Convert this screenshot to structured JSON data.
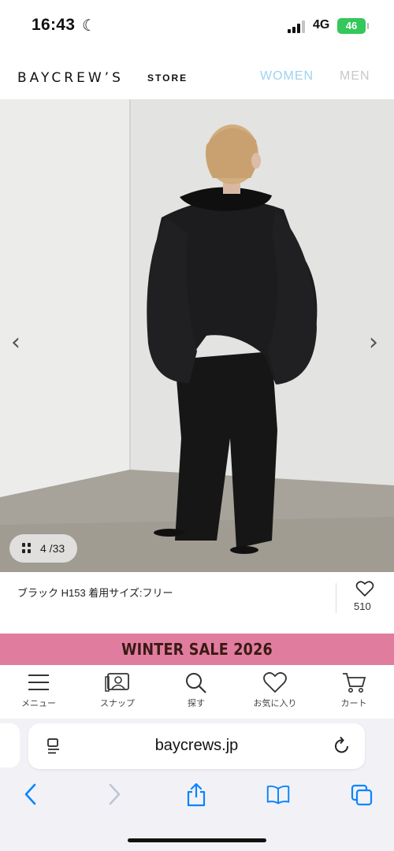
{
  "status_bar": {
    "time": "16:43",
    "network": "4G",
    "battery": "46"
  },
  "header": {
    "logo": "BAYCREW’S",
    "logo_suffix": "STORE",
    "nav_women": "WOMEN",
    "nav_men": "MEN"
  },
  "gallery": {
    "counter": "4 /33",
    "caption": "ブラック H153 着用サイズ:フリー",
    "like_count": "510"
  },
  "sale_banner": {
    "text": "WINTER SALE 2026"
  },
  "tabbar": {
    "items": [
      {
        "label": "メニュー",
        "icon": "hamburger-menu-icon"
      },
      {
        "label": "スナップ",
        "icon": "snap-photo-icon"
      },
      {
        "label": "探す",
        "icon": "search-icon"
      },
      {
        "label": "お気に入り",
        "icon": "heart-icon"
      },
      {
        "label": "カート",
        "icon": "cart-icon"
      }
    ]
  },
  "browser": {
    "url": "baycrews.jp"
  },
  "colors": {
    "women_accent": "#9fd2ee",
    "sale_bg": "#e07d9f",
    "sale_text": "#3a1a14",
    "battery": "#34c759"
  }
}
